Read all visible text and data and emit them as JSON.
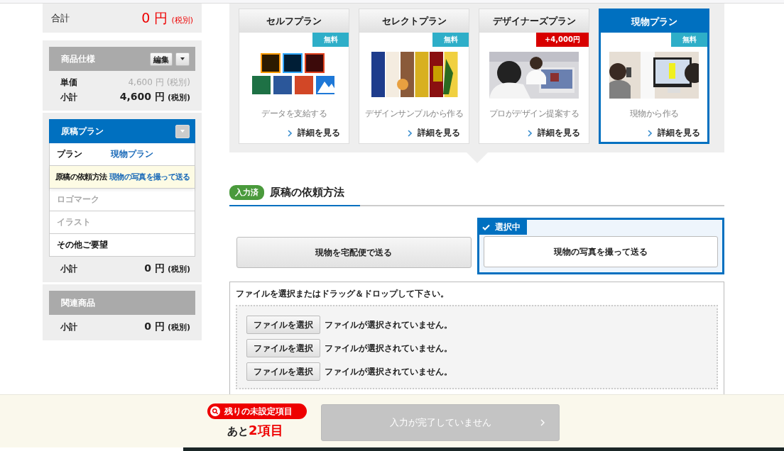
{
  "sidebar": {
    "total": {
      "label": "合計",
      "amount": "0 円",
      "tax": "(税別)"
    },
    "spec": {
      "title": "商品仕様",
      "edit_button": "編集",
      "unit_price": {
        "label": "単価",
        "amount": "4,600 円",
        "tax": "(税別)"
      },
      "subtotal": {
        "label": "小計",
        "amount": "4,600 円",
        "tax": "(税別)"
      }
    },
    "plan_section": {
      "title": "原稿プラン",
      "items": [
        {
          "label": "プラン",
          "value": "現物プラン",
          "highlighted": false,
          "disabled": false
        },
        {
          "label": "原稿の依頼方法",
          "value": "現物の写真を撮って送る",
          "highlighted": true,
          "disabled": false
        },
        {
          "label": "ロゴマーク",
          "highlighted": false,
          "disabled": true
        },
        {
          "label": "イラスト",
          "highlighted": false,
          "disabled": true
        },
        {
          "label": "その他ご要望",
          "highlighted": false,
          "disabled": false
        }
      ],
      "subtotal": {
        "label": "小計",
        "amount": "0 円",
        "tax": "(税別)"
      }
    },
    "related": {
      "title": "関連商品",
      "subtotal": {
        "label": "小計",
        "amount": "0 円",
        "tax": "(税別)"
      }
    }
  },
  "plans": [
    {
      "title": "セルフプラン",
      "badge": "無料",
      "color": "#2eaec8",
      "description": "データを支給する",
      "link": "詳細を見る",
      "selected": false
    },
    {
      "title": "セレクトプラン",
      "badge": "無料",
      "color": "#2eaec8",
      "description": "デザインサンプルから作る",
      "link": "詳細を見る",
      "selected": false
    },
    {
      "title": "デザイナーズプラン",
      "badge": "+4,000円",
      "color": "#d80000",
      "description": "プロがデザイン提案する",
      "link": "詳細を見る",
      "selected": false
    },
    {
      "title": "現物プラン",
      "badge": "無料",
      "color": "#2eaec8",
      "description": "現物から作る",
      "link": "詳細を見る",
      "selected": true
    }
  ],
  "section": {
    "status_badge": "入力済",
    "title": "原稿の依頼方法"
  },
  "methods": [
    {
      "label": "現物を宅配便で送る",
      "selected": false
    },
    {
      "label": "現物の写真を撮って送る",
      "selected": true
    }
  ],
  "selected_tag": "選択中",
  "upload": {
    "instruction": "ファイルを選択またはドラッグ＆ドロップして下さい。",
    "rows": [
      {
        "button": "ファイルを選択",
        "status": "ファイルが選択されていません。"
      },
      {
        "button": "ファイルを選択",
        "status": "ファイルが選択されていません。"
      },
      {
        "button": "ファイルを選択",
        "status": "ファイルが選択されていません。"
      }
    ]
  },
  "footer": {
    "remaining_label": "残りの未設定項目",
    "count_prefix": "あと",
    "count": "2項目",
    "submit": {
      "label": "入力が完了していません",
      "disabled": true
    }
  }
}
